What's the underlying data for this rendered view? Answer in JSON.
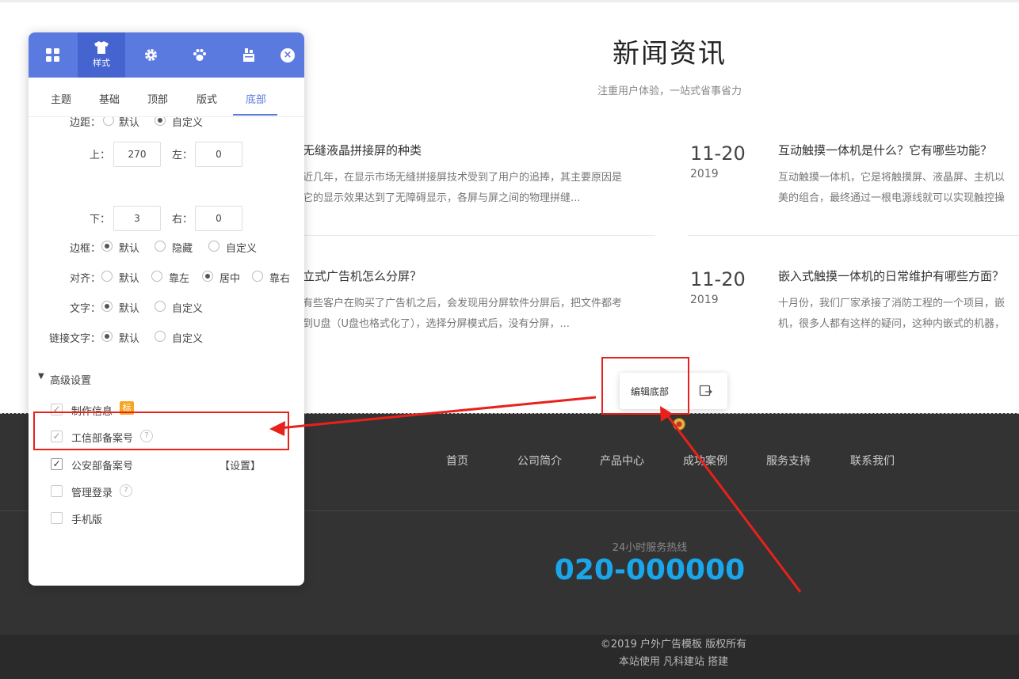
{
  "news": {
    "title": "新闻资讯",
    "subtitle": "注重用户体验，一站式省事省力",
    "articles": [
      {
        "title": "无缝液晶拼接屏的种类",
        "desc1": "近几年，在显示市场无缝拼接屏技术受到了用户的追捧，其主要原因是",
        "desc2": "它的显示效果达到了无障碍显示，各屏与屏之间的物理拼缝..."
      },
      {
        "day": "11-20",
        "year": "2019",
        "title": "互动触摸一体机是什么？它有哪些功能？",
        "desc1": "互动触摸一体机，它是将触摸屏、液晶屏、主机以",
        "desc2": "美的组合，最终通过一根电源线就可以实现触控操"
      },
      {
        "title": "立式广告机怎么分屏？",
        "desc1": "有些客户在购买了广告机之后，会发现用分屏软件分屏后，把文件都考",
        "desc2": "到U盘（U盘也格式化了），选择分屏模式后，没有分屏，..."
      },
      {
        "day": "11-20",
        "year": "2019",
        "title": "嵌入式触摸一体机的日常维护有哪些方面？",
        "desc1": "十月份，我们厂家承接了消防工程的一个项目，嵌",
        "desc2": "机，很多人都有这样的疑问，这种内嵌式的机器，"
      }
    ]
  },
  "edit_footer": {
    "label": "编辑底部",
    "icon": "swap-icon"
  },
  "footer": {
    "nav": [
      "首页",
      "公司简介",
      "产品中心",
      "成功案例",
      "服务支持",
      "联系我们"
    ],
    "hotline_label": "24小时服务热线",
    "hotline": "020-000000",
    "copyright": "©2019 户外广告模板 版权所有",
    "powered": "本站使用 凡科建站 搭建"
  },
  "panel": {
    "tabs": [
      {
        "icon": "grid-icon",
        "label": ""
      },
      {
        "icon": "shirt-icon",
        "label": "样式"
      },
      {
        "icon": "gear-icon",
        "label": ""
      },
      {
        "icon": "paw-icon",
        "label": ""
      },
      {
        "icon": "cabinet-icon",
        "label": ""
      }
    ],
    "subtabs": [
      "主题",
      "基础",
      "顶部",
      "版式",
      "底部"
    ],
    "active_subtab": "底部",
    "margin": {
      "label": "边距：",
      "opt_default": "默认",
      "opt_custom": "自定义",
      "top_label": "上：",
      "top_value": "270",
      "left_label": "左：",
      "left_value": "0",
      "bottom_label": "下：",
      "bottom_value": "3",
      "right_label": "右：",
      "right_value": "0"
    },
    "border": {
      "label": "边框：",
      "options": [
        "默认",
        "隐藏",
        "自定义"
      ],
      "selected": "默认"
    },
    "align": {
      "label": "对齐：",
      "options": [
        "默认",
        "靠左",
        "居中",
        "靠右"
      ],
      "selected": "居中"
    },
    "text": {
      "label": "文字：",
      "options": [
        "默认",
        "自定义"
      ],
      "selected": "默认"
    },
    "link_text": {
      "label": "链接文字：",
      "options": [
        "默认",
        "自定义"
      ],
      "selected": "默认"
    },
    "advanced": {
      "title": "高级设置",
      "items": [
        {
          "label": "制作信息",
          "checked": true,
          "badge": "标"
        },
        {
          "label": "工信部备案号",
          "checked": true
        },
        {
          "label": "公安部备案号",
          "checked": true,
          "action": "【设置】"
        },
        {
          "label": "管理登录",
          "checked": false
        },
        {
          "label": "手机版",
          "checked": false
        }
      ]
    }
  },
  "colors": {
    "accent": "#5a7ae0",
    "annotation": "#e8211b",
    "hotline": "#1aa6ea",
    "footer_bg": "#333333"
  }
}
